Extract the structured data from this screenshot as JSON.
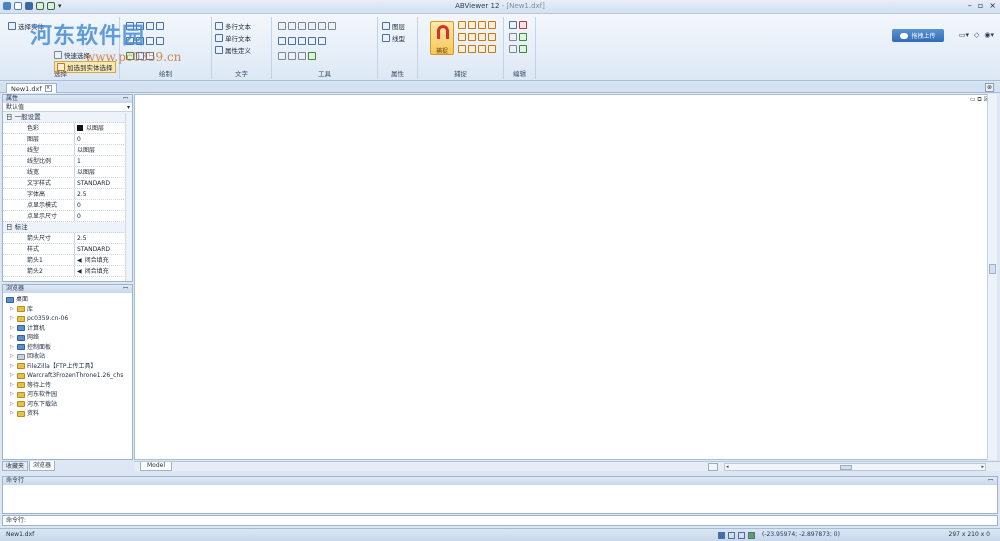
{
  "window": {
    "title": "ABViewer 12",
    "title_suffix": " - [New1.dxf]",
    "controls": [
      "–",
      "▫",
      "×"
    ]
  },
  "watermark": {
    "text": "河东软件园",
    "url": "www.pc0359.cn"
  },
  "ribbon": {
    "groups": [
      {
        "label": "选择"
      },
      {
        "label": "绘制"
      },
      {
        "label": "文字",
        "items": [
          "多行文本",
          "单行文本",
          "属性定义"
        ]
      },
      {
        "label": "工具"
      },
      {
        "label": "属性",
        "items": [
          "图层",
          "线型"
        ]
      },
      {
        "label": "捕捉",
        "big_button": "捕捉"
      },
      {
        "label": "编辑"
      }
    ],
    "select_items": [
      "选择实体",
      "快速选择",
      "加选到实体选择"
    ],
    "upload_label": "拖拽上传"
  },
  "doc_tab": {
    "label": "New1.dxf"
  },
  "properties": {
    "header": "属性",
    "combo_value": "默认值",
    "categories": [
      {
        "title": "日 一般设置",
        "rows": [
          {
            "k": "色彩",
            "v": "以图层",
            "swatch": true
          },
          {
            "k": "图层",
            "v": "0"
          },
          {
            "k": "线型",
            "v": "以图层"
          },
          {
            "k": "线型比例",
            "v": "1"
          },
          {
            "k": "线宽",
            "v": "以图层"
          },
          {
            "k": "文字样式",
            "v": "STANDARD"
          },
          {
            "k": "字体高",
            "v": "2.5"
          },
          {
            "k": "点显示模式",
            "v": "0"
          },
          {
            "k": "点显示尺寸",
            "v": "0"
          }
        ]
      },
      {
        "title": "日 标注",
        "rows": [
          {
            "k": "箭头尺寸",
            "v": "2.5"
          },
          {
            "k": "样式",
            "v": "STANDARD"
          },
          {
            "k": "箭头1",
            "v": "闭合填充",
            "arrow": true
          },
          {
            "k": "箭头2",
            "v": "闭合填充",
            "arrow": true
          }
        ]
      }
    ]
  },
  "browser": {
    "header": "浏览器",
    "root": "桌面",
    "items": [
      {
        "label": "库",
        "icon": "library-icon"
      },
      {
        "label": "pc0359.cn-06",
        "icon": "folder-icon"
      },
      {
        "label": "计算机",
        "icon": "computer-icon"
      },
      {
        "label": "网络",
        "icon": "network-icon"
      },
      {
        "label": "控制面板",
        "icon": "control-panel-icon"
      },
      {
        "label": "回收站",
        "icon": "recycle-bin-icon"
      },
      {
        "label": "FileZilla【FTP上传工具】",
        "icon": "folder-icon"
      },
      {
        "label": "Warcraft3FrozenThrone1.26_chs",
        "icon": "folder-icon"
      },
      {
        "label": "等待上传",
        "icon": "folder-icon"
      },
      {
        "label": "河东软件园",
        "icon": "folder-icon"
      },
      {
        "label": "河东下载站",
        "icon": "folder-icon"
      },
      {
        "label": "资料",
        "icon": "folder-icon"
      }
    ]
  },
  "panel_tabs": [
    "收藏夹",
    "浏览器"
  ],
  "model_tab": "Model",
  "command": {
    "header": "命令行",
    "prompt": "命令行:"
  },
  "status": {
    "file": "New1.dxf",
    "coords": "(-23.95974; -2.897873; 0)",
    "paper_size": "297 x 210 x 0"
  }
}
